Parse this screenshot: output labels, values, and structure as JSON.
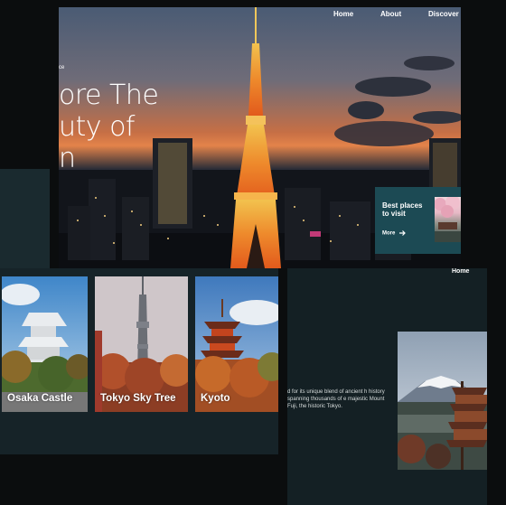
{
  "nav": {
    "home": "Home",
    "about": "About",
    "discover": "Discover"
  },
  "hero": {
    "eyebrow": "ce",
    "headline_line1": "ore The",
    "headline_line2": "uty of",
    "headline_line3": "n"
  },
  "best_card": {
    "title": "Best places to visit",
    "more_label": "More",
    "arrow_icon": "arrow-right-icon"
  },
  "gallery": {
    "cards": [
      {
        "label": "Osaka Castle"
      },
      {
        "label": "Tokyo Sky Tree"
      },
      {
        "label": "Kyoto"
      }
    ]
  },
  "right_panel": {
    "home": "Home",
    "description": "d for its unique blend of ancient h history spanning thousands of e majestic Mount Fuji, the historic Tokyo."
  },
  "colors": {
    "panel_dark": "#162328",
    "card_teal": "#1c4a54",
    "background": "#0b0d0e"
  }
}
